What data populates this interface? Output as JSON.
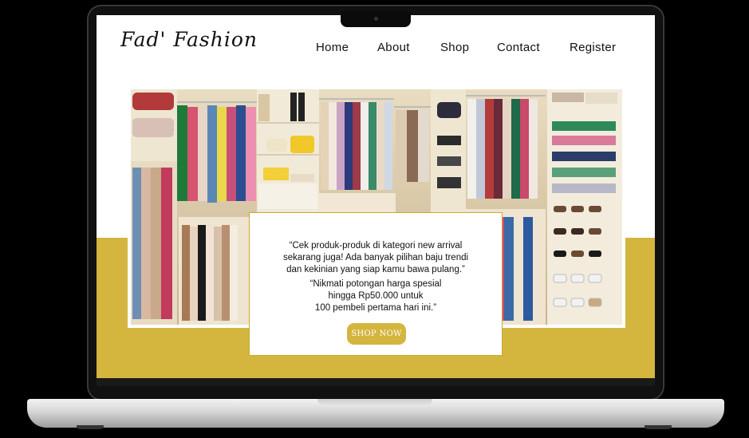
{
  "brand": {
    "logo_text": "Fad' Fashion"
  },
  "nav": {
    "items": [
      {
        "label": "Home"
      },
      {
        "label": "About"
      },
      {
        "label": "Shop"
      },
      {
        "label": "Contact"
      },
      {
        "label": "Register"
      }
    ]
  },
  "hero": {
    "image": "wardrobe-closet-photo"
  },
  "promo": {
    "line1": "“Cek produk-produk di kategori new arrival",
    "line2": "sekarang juga! Ada banyak pilihan baju trendi",
    "line3": "dan kekinian yang siap kamu bawa pulang.”",
    "line4": "“Nikmati potongan harga spesial",
    "line5": "hingga Rp50.000 untuk",
    "line6": "100 pembeli pertama hari ini.”",
    "button_label": "SHOP NOW"
  },
  "colors": {
    "accent": "#d4b53e",
    "background": "#ffffff",
    "text": "#111111"
  }
}
